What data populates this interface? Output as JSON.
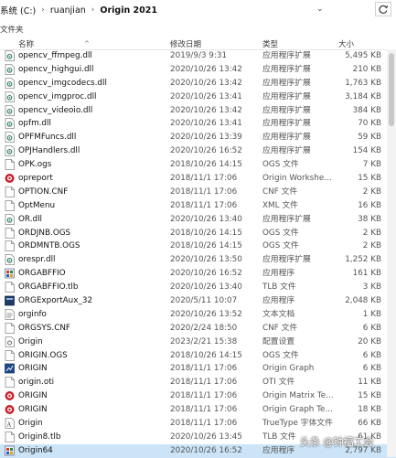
{
  "window": {
    "breadcrumb": [
      "系统 (C:)",
      "ruanjian",
      "Origin 2021"
    ],
    "subtitle": "文件夹"
  },
  "columns": {
    "name": "名称",
    "date": "修改日期",
    "type": "类型",
    "size": "大小"
  },
  "files": [
    {
      "name": "opencv_ffmpeg.dll",
      "date": "2019/9/3 9:31",
      "type": "应用程序扩展",
      "size": "5,495 KB",
      "icon": "dll"
    },
    {
      "name": "opencv_highgui.dll",
      "date": "2020/10/26 13:42",
      "type": "应用程序扩展",
      "size": "210 KB",
      "icon": "dll"
    },
    {
      "name": "opencv_imgcodecs.dll",
      "date": "2020/10/26 13:42",
      "type": "应用程序扩展",
      "size": "1,763 KB",
      "icon": "dll"
    },
    {
      "name": "opencv_imgproc.dll",
      "date": "2020/10/26 13:41",
      "type": "应用程序扩展",
      "size": "3,184 KB",
      "icon": "dll"
    },
    {
      "name": "opencv_videoio.dll",
      "date": "2020/10/26 13:42",
      "type": "应用程序扩展",
      "size": "384 KB",
      "icon": "dll"
    },
    {
      "name": "opfm.dll",
      "date": "2020/10/26 13:41",
      "type": "应用程序扩展",
      "size": "70 KB",
      "icon": "dll"
    },
    {
      "name": "OPFMFuncs.dll",
      "date": "2020/10/26 13:39",
      "type": "应用程序扩展",
      "size": "59 KB",
      "icon": "dll"
    },
    {
      "name": "OPJHandlers.dll",
      "date": "2020/10/26 16:52",
      "type": "应用程序扩展",
      "size": "154 KB",
      "icon": "dll"
    },
    {
      "name": "OPK.ogs",
      "date": "2018/10/26 14:15",
      "type": "OGS 文件",
      "size": "7 KB",
      "icon": "file"
    },
    {
      "name": "opreport",
      "date": "2018/11/1 17:06",
      "type": "Origin Workshe...",
      "size": "15 KB",
      "icon": "origin-red"
    },
    {
      "name": "OPTION.CNF",
      "date": "2018/11/1 17:06",
      "type": "CNF 文件",
      "size": "2 KB",
      "icon": "file"
    },
    {
      "name": "OptMenu",
      "date": "2018/11/1 17:06",
      "type": "XML 文件",
      "size": "16 KB",
      "icon": "file"
    },
    {
      "name": "OR.dll",
      "date": "2020/10/26 13:40",
      "type": "应用程序扩展",
      "size": "38 KB",
      "icon": "dll"
    },
    {
      "name": "ORDJNB.OGS",
      "date": "2018/10/26 14:15",
      "type": "OGS 文件",
      "size": "2 KB",
      "icon": "file"
    },
    {
      "name": "ORDMNTB.OGS",
      "date": "2018/10/26 14:15",
      "type": "OGS 文件",
      "size": "2 KB",
      "icon": "file"
    },
    {
      "name": "orespr.dll",
      "date": "2020/10/26 13:50",
      "type": "应用程序扩展",
      "size": "1,252 KB",
      "icon": "dll"
    },
    {
      "name": "ORGABFFIO",
      "date": "2020/10/26 16:52",
      "type": "应用程序",
      "size": "161 KB",
      "icon": "app"
    },
    {
      "name": "ORGABFFIO.tlb",
      "date": "2020/10/26 13:40",
      "type": "TLB 文件",
      "size": "3 KB",
      "icon": "file"
    },
    {
      "name": "ORGExportAux_32",
      "date": "2020/5/11 10:07",
      "type": "应用程序",
      "size": "2,048 KB",
      "icon": "app-dark"
    },
    {
      "name": "orginfo",
      "date": "2020/10/26 13:52",
      "type": "文本文档",
      "size": "1 KB",
      "icon": "text"
    },
    {
      "name": "ORGSYS.CNF",
      "date": "2020/2/24 18:50",
      "type": "CNF 文件",
      "size": "6 KB",
      "icon": "file"
    },
    {
      "name": "Origin",
      "date": "2023/2/21 15:38",
      "type": "配置设置",
      "size": "20 KB",
      "icon": "config"
    },
    {
      "name": "ORIGIN.OGS",
      "date": "2018/10/26 14:15",
      "type": "OGS 文件",
      "size": "6 KB",
      "icon": "file"
    },
    {
      "name": "ORIGIN",
      "date": "2018/11/1 17:06",
      "type": "Origin Graph",
      "size": "6 KB",
      "icon": "graph"
    },
    {
      "name": "origin.oti",
      "date": "2018/11/1 17:06",
      "type": "OTI 文件",
      "size": "11 KB",
      "icon": "file"
    },
    {
      "name": "ORIGIN",
      "date": "2018/11/1 17:06",
      "type": "Origin Matrix Te...",
      "size": "15 KB",
      "icon": "origin-red"
    },
    {
      "name": "ORIGIN",
      "date": "2018/11/1 17:06",
      "type": "Origin Graph Te...",
      "size": "18 KB",
      "icon": "origin-red"
    },
    {
      "name": "Origin",
      "date": "2018/11/1 17:06",
      "type": "TrueType 字体文件",
      "size": "66 KB",
      "icon": "font"
    },
    {
      "name": "Origin8.tlb",
      "date": "2020/10/26 13:45",
      "type": "TLB 文件",
      "size": "61 KB",
      "icon": "file"
    },
    {
      "name": "Origin64",
      "date": "2020/10/26 16:52",
      "type": "应用程序",
      "size": "2,797 KB",
      "icon": "app",
      "selected": true
    }
  ],
  "watermark": "头条 @钟福工会"
}
